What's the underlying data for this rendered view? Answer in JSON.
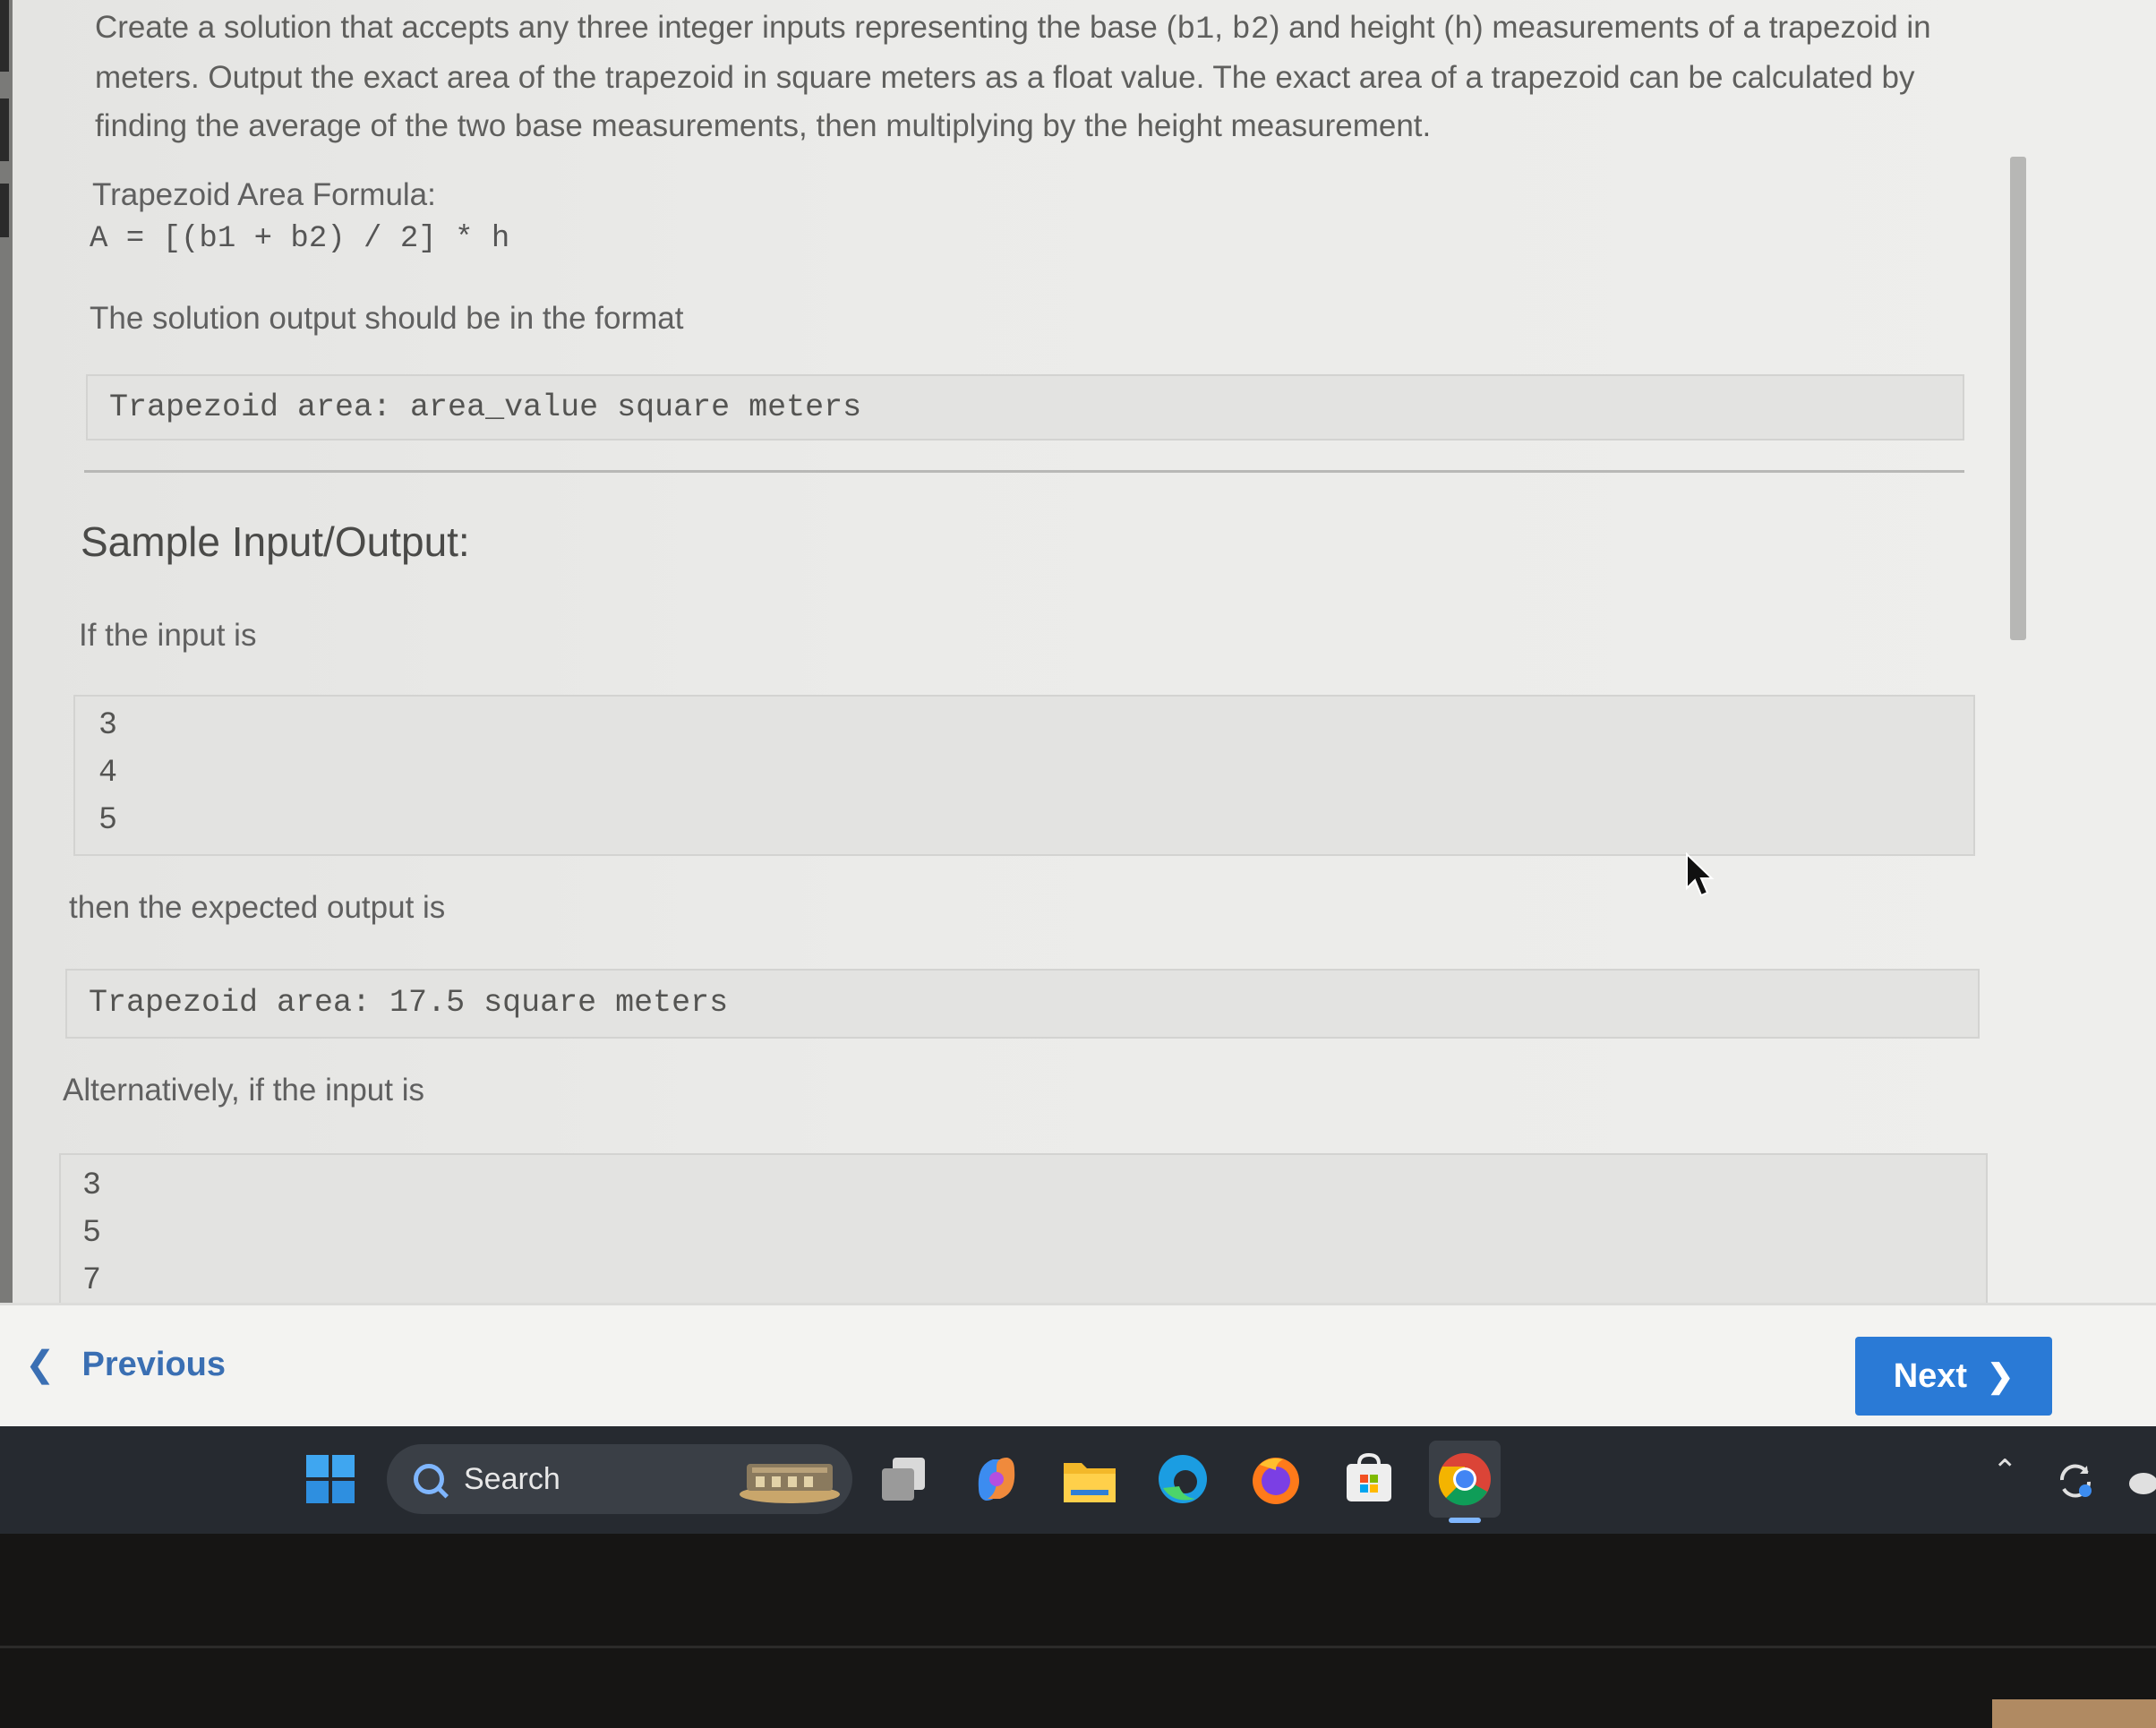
{
  "problem": {
    "intro_parts": [
      "Create a solution that accepts any three integer inputs representing the base (",
      "b1",
      ", ",
      "b2",
      ") and height (",
      "h",
      ") measurements of a trapezoid in meters. Output the exact area of the trapezoid in square meters as a float value. The exact area of a trapezoid can be calculated by finding the average of the two base measurements, then multiplying by the height measurement."
    ],
    "formula_label": "Trapezoid Area Formula:",
    "formula": "A = [(b1 + b2) / 2] * h",
    "format_label": "The solution output should be in the format",
    "format_code": "Trapezoid area: area_value square meters"
  },
  "samples": {
    "heading": "Sample Input/Output:",
    "input_label_1": "If the input is",
    "input_1": [
      "3",
      "4",
      "5"
    ],
    "output_label_1": "then the expected output is",
    "output_1": "Trapezoid area: 17.5 square meters",
    "input_label_2": "Alternatively, if the input is",
    "input_2": [
      "3",
      "5",
      "7"
    ]
  },
  "nav": {
    "previous_label": "Previous",
    "next_label": "Next"
  },
  "taskbar": {
    "search_label": "Search",
    "icons": [
      "windows-start-icon",
      "task-view-icon",
      "copilot-icon",
      "file-explorer-icon",
      "edge-icon",
      "firefox-icon",
      "microsoft-store-icon",
      "chrome-icon"
    ],
    "accent_color": "#2a7ad6"
  }
}
